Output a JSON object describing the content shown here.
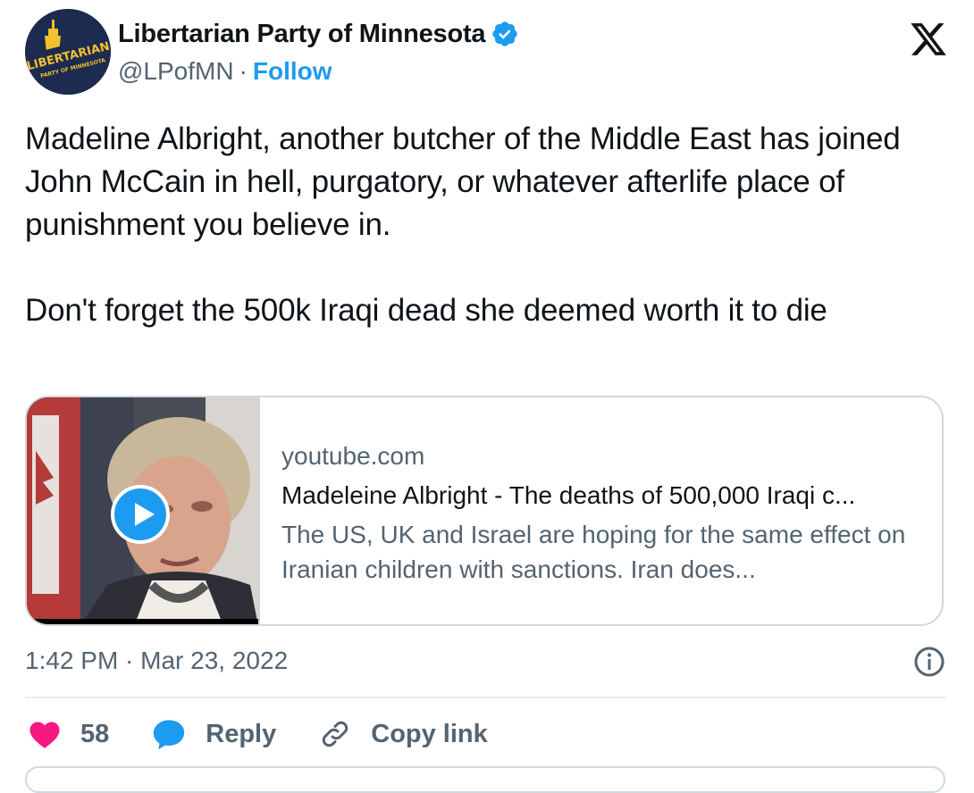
{
  "author": {
    "display_name": "Libertarian Party of Minnesota",
    "handle": "@LPofMN",
    "separator": "·",
    "follow_label": "Follow",
    "avatar_text_top": "LIBERTARIAN",
    "avatar_text_mid": "PARTY OF MINNESOTA",
    "verified": true
  },
  "tweet": {
    "paragraph_1": "Madeline Albright, another butcher of the Middle East has joined John McCain in hell, purgatory, or whatever afterlife place of punishment you believe in.",
    "paragraph_2": "Don't forget the 500k Iraqi dead she deemed worth it to die"
  },
  "link_card": {
    "domain": "youtube.com",
    "title": "Madeleine Albright - The deaths of 500,000 Iraqi c...",
    "description": "The US, UK and Israel are hoping for the same effect on Iranian children with sanctions. Iran does..."
  },
  "timestamp": "1:42 PM · Mar 23, 2022",
  "actions": {
    "likes_count": "58",
    "reply_label": "Reply",
    "copy_link_label": "Copy link"
  },
  "colors": {
    "accent": "#1d9bf0",
    "like": "#f91880",
    "text_primary": "#0f1419",
    "text_secondary": "#536471",
    "border": "#cfd9de"
  },
  "icons": [
    "x-logo-icon",
    "verified-badge-icon",
    "play-icon",
    "info-icon",
    "heart-icon",
    "reply-bubble-icon",
    "link-icon"
  ]
}
